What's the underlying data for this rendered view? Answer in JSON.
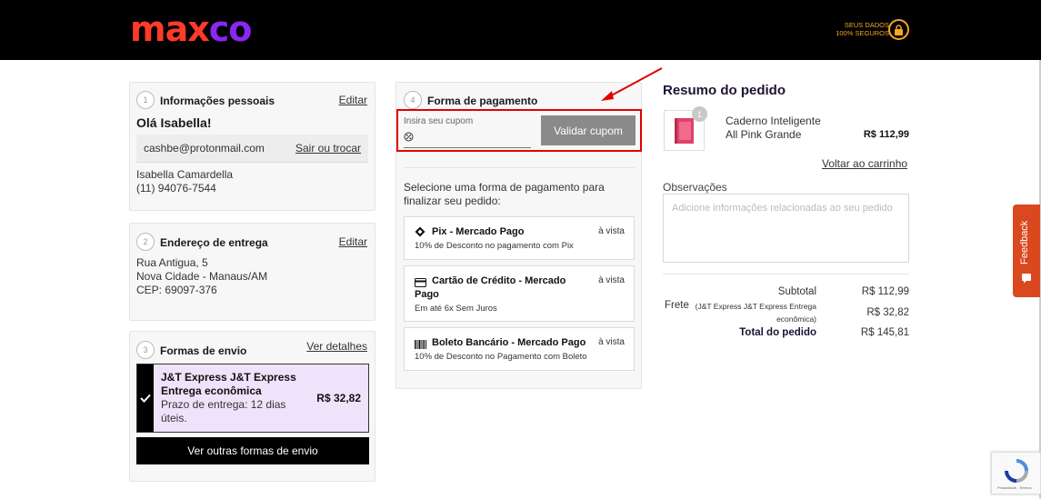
{
  "header": {
    "logo_part1": "max",
    "logo_part2": "co",
    "secure_line1": "SEUS DADOS",
    "secure_line2": "100% SEGUROS"
  },
  "personal": {
    "step": "1",
    "title": "Informações pessoais",
    "edit": "Editar",
    "greeting": "Olá Isabella!",
    "email": "cashbe@protonmail.com",
    "switch": "Sair ou trocar",
    "name": "Isabella Camardella",
    "phone": "(11) 94076-7544"
  },
  "address": {
    "step": "2",
    "title": "Endereço de entrega",
    "edit": "Editar",
    "line1": "Rua Antigua, 5",
    "line2": "Nova Cidade - Manaus/AM",
    "line3": "CEP: 69097-376"
  },
  "shipping": {
    "step": "3",
    "title": "Formas de envio",
    "details": "Ver detalhes",
    "option_name_line1": "J&T Express J&T Express",
    "option_name_line2": "Entrega econômica",
    "option_price": "R$ 32,82",
    "option_eta_line1": "Prazo de entrega: 12 dias",
    "option_eta_line2": "úteis.",
    "more_button": "Ver outras formas de envio"
  },
  "payment": {
    "step": "4",
    "title": "Forma de pagamento",
    "coupon_label": "Insira seu cupom",
    "coupon_button": "Validar cupom",
    "select_line1": "Selecione uma forma de pagamento para",
    "select_line2": "finalizar seu pedido:",
    "options": [
      {
        "title": "Pix - Mercado Pago",
        "title2": "",
        "side": "à vista",
        "sub": "10% de Desconto no pagamento com Pix"
      },
      {
        "title": "Cartão de Crédito - Mercado",
        "title2": "Pago",
        "side": "à vista",
        "sub": "Em até 6x Sem Juros"
      },
      {
        "title": "Boleto Bancário - Mercado Pago",
        "title2": "",
        "side": "à vista",
        "sub": "10% de Desconto no Pagamento com Boleto"
      }
    ]
  },
  "summary": {
    "title": "Resumo do pedido",
    "qty": "1",
    "product_line1": "Caderno Inteligente",
    "product_line2": "All Pink Grande",
    "product_price": "R$ 112,99",
    "back_to_cart": "Voltar ao carrinho",
    "obs_label": "Observações",
    "obs_placeholder": "Adicione informações relacionadas ao seu pedido",
    "subtotal_label": "Subtotal",
    "subtotal_value": "R$ 112,99",
    "freight_label": "Frete",
    "freight_detail_line1": "(J&T Express J&T Express Entrega",
    "freight_detail_line2": "econômica)",
    "freight_value": "R$ 32,82",
    "total_label": "Total do pedido",
    "total_value": "R$ 145,81"
  },
  "widgets": {
    "feedback": "Feedback",
    "recaptcha_text": "Privacidade - Termos"
  },
  "colors": {
    "brand_red": "#ff3a2b",
    "brand_purple": "#8a27f2",
    "secure_orange": "#f5a623",
    "annotation_red": "#e30000",
    "feedback_orange": "#d9481f"
  }
}
